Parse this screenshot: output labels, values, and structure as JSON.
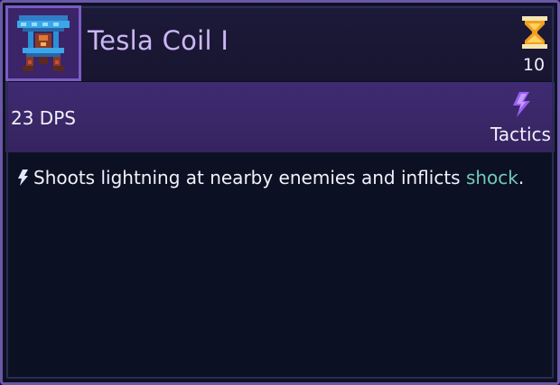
{
  "card": {
    "title": "Tesla Coil I",
    "portrait_icon": "tesla-coil-tower-icon",
    "cost": {
      "icon": "hourglass-icon",
      "value": "10"
    },
    "dps": "23 DPS",
    "category": {
      "icon": "lightning-bolt-icon",
      "label": "Tactics",
      "color": "#9b5df0"
    },
    "description": {
      "icon": "small-bolt-icon",
      "text_before": "Shoots lightning at nearby enemies and inflicts ",
      "keyword": "shock",
      "text_after": ".",
      "keyword_color": "#74c9b8"
    }
  }
}
